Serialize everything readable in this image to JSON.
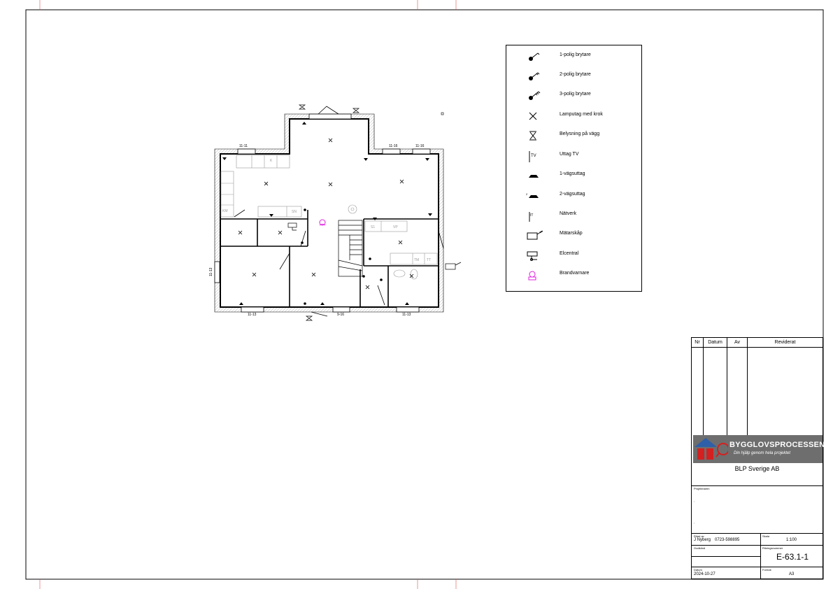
{
  "plan": {
    "dimension_labels": [
      "11-11",
      "11-16",
      "11-16",
      "11-13",
      "11-13",
      "9-16",
      "11-13"
    ],
    "room_labels": [
      "SN",
      "K",
      "S1",
      "VP",
      "TM",
      "TT",
      "KM"
    ],
    "colors": {
      "smoke_detector": "#e020e0",
      "wall": "#000000",
      "hatch": "#8a8a8a"
    }
  },
  "legend": {
    "items": [
      {
        "icon": "switch-1pole-icon",
        "label": "1-polig brytare"
      },
      {
        "icon": "switch-2pole-icon",
        "label": "2-polig brytare"
      },
      {
        "icon": "switch-3pole-icon",
        "label": "3-polig brytare"
      },
      {
        "icon": "lamp-hook-icon",
        "label": "Lamputag  med krok"
      },
      {
        "icon": "wall-light-icon",
        "label": "Belysning på vägg"
      },
      {
        "icon": "tv-outlet-icon",
        "label": "Uttag TV"
      },
      {
        "icon": "outlet-1way-icon",
        "label": "1-vägsuttag"
      },
      {
        "icon": "outlet-2way-icon",
        "label": "2-vägsuttag"
      },
      {
        "icon": "network-outlet-icon",
        "label": "Nätverk"
      },
      {
        "icon": "meter-cabinet-icon",
        "label": "Mätarskåp"
      },
      {
        "icon": "electrical-panel-icon",
        "label": "Elcentral"
      },
      {
        "icon": "smoke-detector-icon",
        "label": "Brandvarnare"
      }
    ]
  },
  "title_block": {
    "revision_headers": {
      "nr": "Nr",
      "datum": "Datum",
      "av": "Av",
      "reviderat": "Reviderat"
    },
    "logo_title": "BYGGLOVSPROCESSEN",
    "logo_subtitle": "Din hjälp genom hela projektet",
    "company": "BLP Sverige AB",
    "project_label": "Projektnamn",
    "drawn_by_label": "Ritad av",
    "drawn_by": "J Nyberg",
    "phone": "0723-598895",
    "scale_label": "Skala",
    "scale": "1:100",
    "approved_label": "Godkänd",
    "drawing_number_label": "Ritningsnummer",
    "drawing_number": "E-63.1-1",
    "date_label": "Datum",
    "date": "2024-10-27",
    "format_label": "Format",
    "format": "A3"
  }
}
